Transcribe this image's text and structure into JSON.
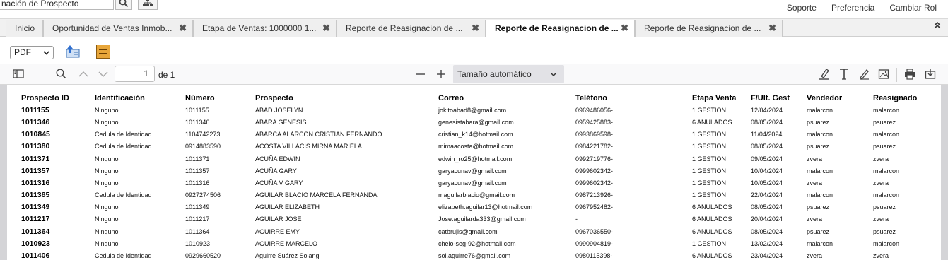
{
  "topbar": {
    "search_value": "nación de Prospecto",
    "links": [
      "Soporte",
      "Preferencia",
      "Cambiar Rol"
    ]
  },
  "tabs": [
    {
      "label": "Inicio",
      "closable": false,
      "active": false
    },
    {
      "label": "Oportunidad de Ventas Inmob...",
      "closable": true,
      "active": false
    },
    {
      "label": "Etapa de Ventas: 1000000 1...",
      "closable": true,
      "active": false
    },
    {
      "label": "Reporte de Reasignacion de ...",
      "closable": true,
      "active": false
    },
    {
      "label": "Reporte de Reasignacion de ...",
      "closable": true,
      "active": true
    },
    {
      "label": "Reporte de Reasignacion de ...",
      "closable": true,
      "active": false
    }
  ],
  "close_glyph": "✖",
  "collapse_glyph": "⌃⌃",
  "toolbar": {
    "format_selected": "PDF"
  },
  "pdfviewer": {
    "page_value": "1",
    "page_of": "de 1",
    "zoom_label": "Tamaño automático"
  },
  "report": {
    "headers": [
      "Prospecto ID",
      "Identificación",
      "Número",
      "Prospecto",
      "Correo",
      "Teléfono",
      "Etapa Venta",
      "F/Ult. Gest",
      "Vendedor",
      "Reasignado"
    ],
    "rows": [
      [
        "1011155",
        "Ninguno",
        "1011155",
        "ABAD JOSELYN",
        "jokitoabad8@gmail.com",
        "0969486056-",
        "1 GESTION",
        "12/04/2024",
        "malarcon",
        "malarcon"
      ],
      [
        "1011346",
        "Ninguno",
        "1011346",
        "ABARA GENESIS",
        "genesistabara@gmail.com",
        "0959425883-",
        "6 ANULADOS",
        "08/05/2024",
        "psuarez",
        "psuarez"
      ],
      [
        "1010845",
        "Cedula de Identidad",
        "1104742273",
        "ABARCA ALARCON CRISTIAN FERNANDO",
        "cristian_k14@hotmail.com",
        "0993869598-",
        "1 GESTION",
        "11/04/2024",
        "malarcon",
        "malarcon"
      ],
      [
        "1011380",
        "Cedula de Identidad",
        "0914883590",
        "ACOSTA VILLACIS MIRNA MARIELA",
        "mimaacosta@hotmail.com",
        "0984221782-",
        "1 GESTION",
        "08/05/2024",
        "psuarez",
        "psuarez"
      ],
      [
        "1011371",
        "Ninguno",
        "1011371",
        "ACUÑA EDWIN",
        " edwin_ro25@hotmail.com",
        "0992719776-",
        "1 GESTION",
        "09/05/2024",
        "zvera",
        "zvera"
      ],
      [
        "1011357",
        "Ninguno",
        "1011357",
        "ACUÑA GARY",
        "garyacunav@gmail.com",
        "0999602342-",
        "1 GESTION",
        "10/04/2024",
        "malarcon",
        "malarcon"
      ],
      [
        "1011316",
        "Ninguno",
        "1011316",
        "ACUÑA V GARY",
        "garyacunav@gmail.com",
        "0999602342-",
        "1 GESTION",
        "10/05/2024",
        "zvera",
        "zvera"
      ],
      [
        "1011385",
        "Cedula de Identidad",
        "0927274506",
        "AGUILAR BLACIO MARCELA FERNANDA",
        "maguilarblacio@gmail.com",
        "0987213926-",
        "1 GESTION",
        "22/04/2024",
        "malarcon",
        "malarcon"
      ],
      [
        "1011349",
        "Ninguno",
        "1011349",
        "AGUILAR ELIZABETH",
        "elizabeth.aguilar13@hotmail.com",
        "0967952482-",
        "6 ANULADOS",
        "08/05/2024",
        "psuarez",
        "psuarez"
      ],
      [
        "1011217",
        "Ninguno",
        "1011217",
        "AGUILAR JOSE",
        "Jose.aguilarda333@gmail.com",
        "-",
        "6 ANULADOS",
        "20/04/2024",
        "zvera",
        "zvera"
      ],
      [
        "1011364",
        "Ninguno",
        "1011364",
        "AGUIRRE EMY",
        "catbrujis@gmail.com",
        "0967036550-",
        "6 ANULADOS",
        "08/05/2024",
        "psuarez",
        "psuarez"
      ],
      [
        "1010923",
        "Ninguno",
        "1010923",
        "AGUIRRE MARCELO",
        "chelo-seg-92@hotmail.com",
        "0990904819-",
        "1 GESTION",
        "13/02/2024",
        "malarcon",
        "malarcon"
      ],
      [
        "1011406",
        "Cedula de Identidad",
        "0929660520",
        "Aguirre Suárez Solangi",
        "sol.aguirre76@gmail.com",
        "0980115398-",
        "6 ANULADOS",
        "23/04/2024",
        "zvera",
        "zvera"
      ]
    ]
  }
}
